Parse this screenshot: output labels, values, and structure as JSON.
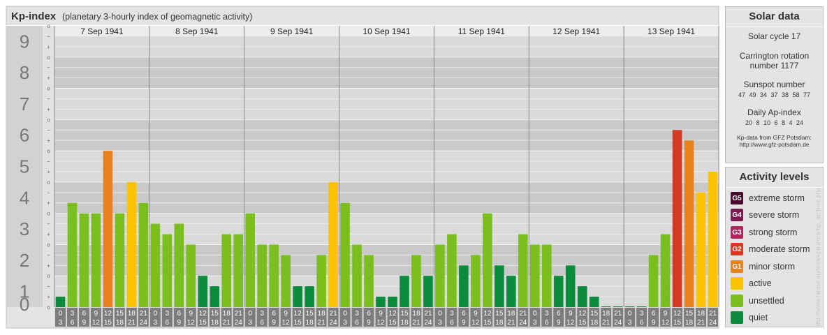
{
  "header": {
    "title": "Kp-index",
    "subtitle": "(planetary 3-hourly index of geomagnetic activity)"
  },
  "chart_data": {
    "type": "bar",
    "title": "Kp-index",
    "subtitle": "(planetary 3-hourly index of geomagnetic activity)",
    "ylim": [
      0,
      9
    ],
    "y_ticks": [
      "0",
      "1",
      "2",
      "3",
      "4",
      "5",
      "6",
      "7",
      "8",
      "9"
    ],
    "minor_tick_labels": [
      "o",
      "+",
      "−"
    ],
    "days": [
      "7 Sep 1941",
      "8 Sep 1941",
      "9 Sep 1941",
      "10 Sep 1941",
      "11 Sep 1941",
      "12 Sep 1941",
      "13 Sep 1941"
    ],
    "interval_start_labels": [
      "0",
      "3",
      "6",
      "9",
      "12",
      "15",
      "18",
      "21"
    ],
    "interval_end_labels": [
      "3",
      "6",
      "9",
      "12",
      "15",
      "18",
      "21",
      "24"
    ],
    "values": [
      [
        0.333,
        3.333,
        3.0,
        3.0,
        5.0,
        3.0,
        4.0,
        3.333
      ],
      [
        2.667,
        2.333,
        2.667,
        2.0,
        1.0,
        0.667,
        2.333,
        2.333
      ],
      [
        3.0,
        2.0,
        2.0,
        1.667,
        0.667,
        0.667,
        1.667,
        4.0
      ],
      [
        3.333,
        2.0,
        1.667,
        0.333,
        0.333,
        1.0,
        1.667,
        1.0
      ],
      [
        2.0,
        2.333,
        1.333,
        1.667,
        3.0,
        1.333,
        1.0,
        2.333
      ],
      [
        2.0,
        2.0,
        1.0,
        1.333,
        0.667,
        0.333,
        0.0,
        0.0
      ],
      [
        0.0,
        0.0,
        1.667,
        2.333,
        5.667,
        5.333,
        3.667,
        4.333
      ]
    ]
  },
  "solar": {
    "title": "Solar data",
    "cycle": "Solar cycle 17",
    "carrington_line1": "Carrington rotation",
    "carrington_line2": "number 1177",
    "sunspot_title": "Sunspot number",
    "sunspot_values": "47 49 34 37 38 58 77",
    "ap_title": "Daily Ap-index",
    "ap_values": "20 8 10 6 8 4 24",
    "credit_line1": "Kp-data from GFZ Potsdam:",
    "credit_line2": "http://www.gfz-potsdam.de"
  },
  "activity": {
    "title": "Activity levels",
    "levels": [
      {
        "badge": "G5",
        "label": "extreme storm",
        "color": "#4a0a2e"
      },
      {
        "badge": "G4",
        "label": "severe storm",
        "color": "#7a1a4e"
      },
      {
        "badge": "G3",
        "label": "strong storm",
        "color": "#b0245e"
      },
      {
        "badge": "G2",
        "label": "moderate storm",
        "color": "#d63a22"
      },
      {
        "badge": "G1",
        "label": "minor storm",
        "color": "#e8821e"
      },
      {
        "badge": "",
        "label": "active",
        "color": "#fcc300"
      },
      {
        "badge": "",
        "label": "unsettled",
        "color": "#7abf1e"
      },
      {
        "badge": "",
        "label": "quiet",
        "color": "#0a8c3c"
      }
    ]
  },
  "watermark": "http://www.tieuse.eu/lei/a/kpaurora/bp_archive.php"
}
